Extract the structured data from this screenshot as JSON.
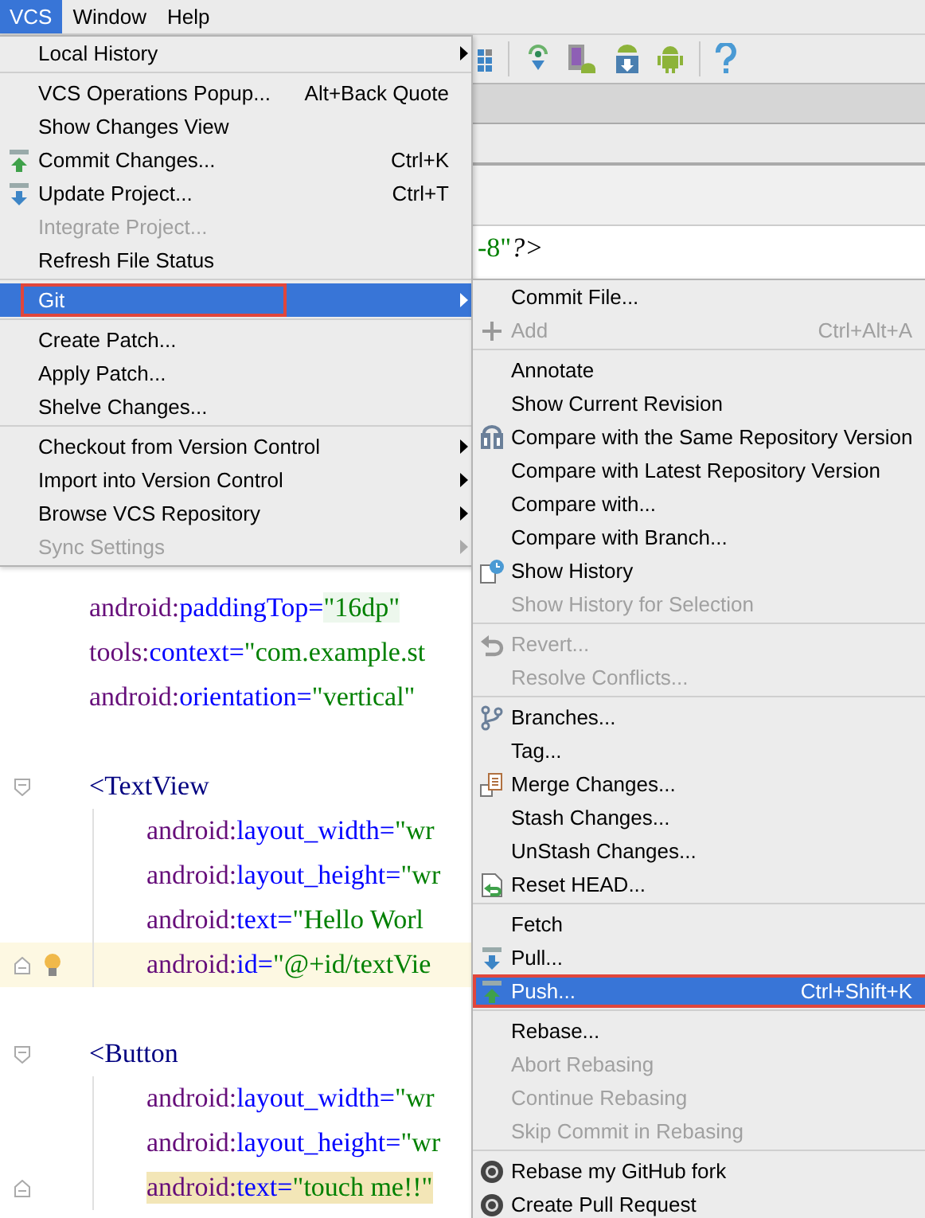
{
  "menubar": [
    {
      "label": "VCS",
      "selected": true
    },
    {
      "label": "Window",
      "selected": false
    },
    {
      "label": "Help",
      "selected": false
    }
  ],
  "vcs_menu": {
    "sections": [
      [
        {
          "label": "Local History",
          "submenu": true,
          "disabled": false,
          "selected": false,
          "annotated": false
        }
      ],
      [
        {
          "label": "VCS Operations Popup...",
          "shortcut": "Alt+Back Quote",
          "submenu": false,
          "disabled": false,
          "selected": false,
          "annotated": false
        },
        {
          "label": "Show Changes View",
          "submenu": false,
          "disabled": false,
          "selected": false,
          "annotated": false
        },
        {
          "label": "Commit Changes...",
          "shortcut": "Ctrl+K",
          "submenu": false,
          "disabled": false,
          "selected": false,
          "annotated": false
        },
        {
          "label": "Update Project...",
          "shortcut": "Ctrl+T",
          "submenu": false,
          "disabled": false,
          "selected": false,
          "annotated": false
        },
        {
          "label": "Integrate Project...",
          "submenu": false,
          "disabled": true,
          "selected": false,
          "annotated": false
        },
        {
          "label": "Refresh File Status",
          "submenu": false,
          "disabled": false,
          "selected": false,
          "annotated": false
        }
      ],
      [
        {
          "label": "Git",
          "submenu": true,
          "disabled": false,
          "selected": true,
          "annotated": true
        }
      ],
      [
        {
          "label": "Create Patch...",
          "submenu": false,
          "disabled": false,
          "selected": false,
          "annotated": false
        },
        {
          "label": "Apply Patch...",
          "submenu": false,
          "disabled": false,
          "selected": false,
          "annotated": false
        },
        {
          "label": "Shelve Changes...",
          "submenu": false,
          "disabled": false,
          "selected": false,
          "annotated": false
        }
      ],
      [
        {
          "label": "Checkout from Version Control",
          "submenu": true,
          "disabled": false,
          "selected": false,
          "annotated": false
        },
        {
          "label": "Import into Version Control",
          "submenu": true,
          "disabled": false,
          "selected": false,
          "annotated": false
        },
        {
          "label": "Browse VCS Repository",
          "submenu": true,
          "disabled": false,
          "selected": false,
          "annotated": false
        },
        {
          "label": "Sync Settings",
          "submenu": true,
          "disabled": true,
          "selected": false,
          "annotated": false
        }
      ]
    ]
  },
  "git_menu": {
    "sections": [
      [
        {
          "label": "Commit File...",
          "submenu": false,
          "disabled": false,
          "selected": false,
          "annotated": false
        },
        {
          "label": "Add",
          "shortcut": "Ctrl+Alt+A",
          "submenu": false,
          "disabled": true,
          "selected": false,
          "annotated": false
        }
      ],
      [
        {
          "label": "Annotate",
          "submenu": false,
          "disabled": false,
          "selected": false,
          "annotated": false
        },
        {
          "label": "Show Current Revision",
          "submenu": false,
          "disabled": false,
          "selected": false,
          "annotated": false
        },
        {
          "label": "Compare with the Same Repository Version",
          "submenu": false,
          "disabled": false,
          "selected": false,
          "annotated": false
        },
        {
          "label": "Compare with Latest Repository Version",
          "submenu": false,
          "disabled": false,
          "selected": false,
          "annotated": false
        },
        {
          "label": "Compare with...",
          "submenu": false,
          "disabled": false,
          "selected": false,
          "annotated": false
        },
        {
          "label": "Compare with Branch...",
          "submenu": false,
          "disabled": false,
          "selected": false,
          "annotated": false
        },
        {
          "label": "Show History",
          "submenu": false,
          "disabled": false,
          "selected": false,
          "annotated": false
        },
        {
          "label": "Show History for Selection",
          "submenu": false,
          "disabled": true,
          "selected": false,
          "annotated": false
        }
      ],
      [
        {
          "label": "Revert...",
          "submenu": false,
          "disabled": true,
          "selected": false,
          "annotated": false
        },
        {
          "label": "Resolve Conflicts...",
          "submenu": false,
          "disabled": true,
          "selected": false,
          "annotated": false
        }
      ],
      [
        {
          "label": "Branches...",
          "submenu": false,
          "disabled": false,
          "selected": false,
          "annotated": false
        },
        {
          "label": "Tag...",
          "submenu": false,
          "disabled": false,
          "selected": false,
          "annotated": false
        },
        {
          "label": "Merge Changes...",
          "submenu": false,
          "disabled": false,
          "selected": false,
          "annotated": false
        },
        {
          "label": "Stash Changes...",
          "submenu": false,
          "disabled": false,
          "selected": false,
          "annotated": false
        },
        {
          "label": "UnStash Changes...",
          "submenu": false,
          "disabled": false,
          "selected": false,
          "annotated": false
        },
        {
          "label": "Reset HEAD...",
          "submenu": false,
          "disabled": false,
          "selected": false,
          "annotated": false
        }
      ],
      [
        {
          "label": "Fetch",
          "submenu": false,
          "disabled": false,
          "selected": false,
          "annotated": false
        },
        {
          "label": "Pull...",
          "submenu": false,
          "disabled": false,
          "selected": false,
          "annotated": false
        },
        {
          "label": "Push...",
          "shortcut": "Ctrl+Shift+K",
          "submenu": false,
          "disabled": false,
          "selected": true,
          "annotated": true
        }
      ],
      [
        {
          "label": "Rebase...",
          "submenu": false,
          "disabled": false,
          "selected": false,
          "annotated": false
        },
        {
          "label": "Abort Rebasing",
          "submenu": false,
          "disabled": true,
          "selected": false,
          "annotated": false
        },
        {
          "label": "Continue Rebasing",
          "submenu": false,
          "disabled": true,
          "selected": false,
          "annotated": false
        },
        {
          "label": "Skip Commit in Rebasing",
          "submenu": false,
          "disabled": true,
          "selected": false,
          "annotated": false
        }
      ],
      [
        {
          "label": "Rebase my GitHub fork",
          "submenu": false,
          "disabled": false,
          "selected": false,
          "annotated": false
        },
        {
          "label": "Create Pull Request",
          "submenu": false,
          "disabled": false,
          "selected": false,
          "annotated": false
        }
      ]
    ]
  },
  "editor": {
    "top_line": [
      {
        "kind": "value",
        "text": "-8\""
      },
      {
        "kind": "plain",
        "text": "?>"
      }
    ],
    "lines": [
      {
        "caret_line": false,
        "selected": false,
        "segments": [
          {
            "kind": "ns",
            "text": "android:"
          },
          {
            "kind": "attr",
            "text": "paddingTop="
          },
          {
            "kind": "marked",
            "text": "\"16dp\""
          }
        ]
      },
      {
        "caret_line": false,
        "selected": false,
        "segments": [
          {
            "kind": "ns",
            "text": "tools:"
          },
          {
            "kind": "attr",
            "text": "context="
          },
          {
            "kind": "value",
            "text": "\"com.example.st"
          }
        ]
      },
      {
        "caret_line": false,
        "selected": false,
        "segments": [
          {
            "kind": "ns",
            "text": "android:"
          },
          {
            "kind": "attr",
            "text": "orientation="
          },
          {
            "kind": "value",
            "text": "\"vertical\""
          }
        ]
      },
      {
        "caret_line": false,
        "selected": false,
        "segments": [
          {
            "kind": "tag",
            "text": "<TextView"
          }
        ],
        "children": [
          {
            "caret_line": false,
            "selected": false,
            "segments": [
              {
                "kind": "ns",
                "text": "android:"
              },
              {
                "kind": "attr",
                "text": "layout_width="
              },
              {
                "kind": "value",
                "text": "\"wr"
              }
            ]
          },
          {
            "caret_line": false,
            "selected": false,
            "segments": [
              {
                "kind": "ns",
                "text": "android:"
              },
              {
                "kind": "attr",
                "text": "layout_height="
              },
              {
                "kind": "value",
                "text": "\"wr"
              }
            ]
          },
          {
            "caret_line": false,
            "selected": false,
            "segments": [
              {
                "kind": "ns",
                "text": "android:"
              },
              {
                "kind": "attr",
                "text": "text="
              },
              {
                "kind": "value",
                "text": "\"Hello Worl"
              }
            ]
          },
          {
            "caret_line": true,
            "selected": false,
            "segments": [
              {
                "kind": "ns",
                "text": "android:"
              },
              {
                "kind": "attr",
                "text": "id="
              },
              {
                "kind": "value",
                "text": "\"@+id/textVie"
              }
            ]
          }
        ]
      },
      {
        "caret_line": false,
        "selected": false,
        "segments": [
          {
            "kind": "tag",
            "text": "<Button"
          }
        ],
        "children": [
          {
            "caret_line": false,
            "selected": false,
            "segments": [
              {
                "kind": "ns",
                "text": "android:"
              },
              {
                "kind": "attr",
                "text": "layout_width="
              },
              {
                "kind": "value",
                "text": "\"wr"
              }
            ]
          },
          {
            "caret_line": false,
            "selected": false,
            "segments": [
              {
                "kind": "ns",
                "text": "android:"
              },
              {
                "kind": "attr",
                "text": "layout_height="
              },
              {
                "kind": "value",
                "text": "\"wr"
              }
            ]
          },
          {
            "caret_line": false,
            "selected": true,
            "segments": [
              {
                "kind": "ns",
                "text": "android:"
              },
              {
                "kind": "attr",
                "text": "text="
              },
              {
                "kind": "value",
                "text": "\"touch me!!\""
              }
            ]
          }
        ]
      }
    ]
  }
}
